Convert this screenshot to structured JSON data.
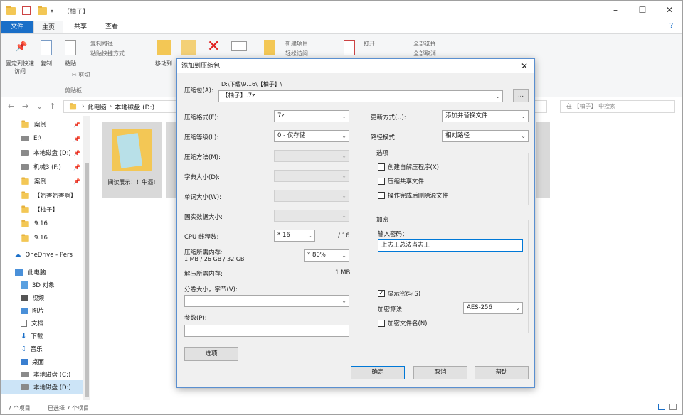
{
  "explorer": {
    "title": "【柚子】",
    "ribbon_tabs": [
      "文件",
      "主页",
      "共享",
      "查看"
    ],
    "ribbon": {
      "pin_label": "固定到快速访问",
      "copy_label": "复制",
      "paste_label": "粘贴",
      "copy_path": "复制路径",
      "paste_shortcut": "粘贴快捷方式",
      "cut": "剪切",
      "clipboard_group": "剪贴板",
      "move_to": "移动到",
      "new_item": "新建项目",
      "easy_access": "轻松访问",
      "open": "打开",
      "select_all": "全部选择",
      "select_none": "全部取消"
    },
    "address": [
      "此电脑",
      "本地磁盘 (D:)"
    ],
    "search_placeholder": "在 【柚子】 中搜索",
    "sidebar": [
      {
        "label": "案例",
        "type": "folder"
      },
      {
        "label": "E:\\",
        "type": "drive"
      },
      {
        "label": "本地磁盘 (D:)",
        "type": "drive"
      },
      {
        "label": "机械3 (F:)",
        "type": "drive"
      },
      {
        "label": "案例",
        "type": "folder"
      },
      {
        "label": "【奶香奶香啊】",
        "type": "folder"
      },
      {
        "label": "【柚子】",
        "type": "folder"
      },
      {
        "label": "9.16",
        "type": "folder"
      },
      {
        "label": "9.16",
        "type": "folder"
      },
      {
        "label": "OneDrive - Pers",
        "type": "cloud"
      },
      {
        "label": "此电脑",
        "type": "pc"
      },
      {
        "label": "3D 对象",
        "type": "folder"
      },
      {
        "label": "视频",
        "type": "folder"
      },
      {
        "label": "图片",
        "type": "folder"
      },
      {
        "label": "文档",
        "type": "folder"
      },
      {
        "label": "下载",
        "type": "folder"
      },
      {
        "label": "音乐",
        "type": "folder"
      },
      {
        "label": "桌面",
        "type": "folder"
      },
      {
        "label": "本地磁盘 (C:)",
        "type": "drive"
      },
      {
        "label": "本地磁盘 (D:)",
        "type": "drive"
      }
    ],
    "tile_label": "阅读展示！！牛逼!",
    "status": {
      "count": "7 个项目",
      "selected": "已选择 7 个项目"
    }
  },
  "dialog": {
    "title": "添加到压缩包",
    "archive_label": "压缩包(A):",
    "archive_dir": "D:\\下载\\9.16\\【柚子】\\",
    "archive_name": "【柚子】.7z",
    "browse": "...",
    "format_label": "压缩格式(F):",
    "format_value": "7z",
    "level_label": "压缩等级(L):",
    "level_value": "0 - 仅存储",
    "method_label": "压缩方法(M):",
    "dict_label": "字典大小(D):",
    "word_label": "单词大小(W):",
    "solid_label": "固实数据大小:",
    "cpu_label": "CPU 线程数:",
    "cpu_value": "* 16",
    "cpu_total": "/ 16",
    "mem_comp_label": "压缩所需内存:",
    "mem_comp_detail": "1 MB / 26 GB / 32 GB",
    "mem_comp_value": "* 80%",
    "mem_decomp_label": "解压所需内存:",
    "mem_decomp_value": "1 MB",
    "split_label": "分卷大小，字节(V):",
    "params_label": "参数(P):",
    "options_button": "选项",
    "update_label": "更新方式(U):",
    "update_value": "添加并替换文件",
    "path_label": "路径模式",
    "path_value": "相对路径",
    "options_group": "选项",
    "opt_sfx": "创建自解压程序(X)",
    "opt_shared": "压缩共享文件",
    "opt_delete": "操作完成后删除源文件",
    "encrypt_group": "加密",
    "password_label": "输入密码：",
    "password_value": "上志王总法当志王",
    "show_password": "显示密码(S)",
    "encrypt_method_label": "加密算法:",
    "encrypt_method_value": "AES-256",
    "encrypt_names": "加密文件名(N)",
    "ok": "确定",
    "cancel": "取消",
    "help": "帮助"
  }
}
